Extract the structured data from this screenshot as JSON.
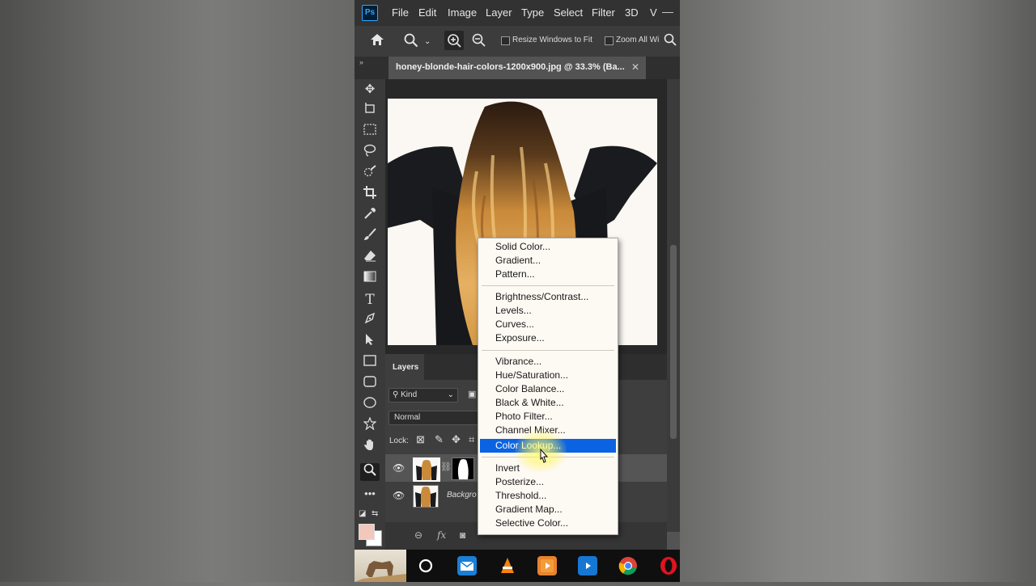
{
  "app": {
    "logo": "Ps"
  },
  "menu": {
    "items": [
      "File",
      "Edit",
      "Image",
      "Layer",
      "Type",
      "Select",
      "Filter",
      "3D",
      "V"
    ]
  },
  "options": {
    "resize_windows": "Resize Windows to Fit",
    "zoom_all": "Zoom All Wi"
  },
  "document": {
    "tab_title": "honey-blonde-hair-colors-1200x900.jpg @ 33.3% (Ba..."
  },
  "layers_panel": {
    "title": "Layers",
    "filter_label": "Kind",
    "blend_mode": "Normal",
    "lock_label": "Lock:",
    "layers": [
      {
        "name": "",
        "has_mask": true
      },
      {
        "name": "Backgro"
      }
    ]
  },
  "context_menu": {
    "groups": [
      [
        "Solid Color...",
        "Gradient...",
        "Pattern..."
      ],
      [
        "Brightness/Contrast...",
        "Levels...",
        "Curves...",
        "Exposure..."
      ],
      [
        "Vibrance...",
        "Hue/Saturation...",
        "Color Balance...",
        "Black & White...",
        "Photo Filter...",
        "Channel Mixer...",
        "Color Lookup..."
      ],
      [
        "Invert",
        "Posterize...",
        "Threshold...",
        "Gradient Map...",
        "Selective Color..."
      ]
    ],
    "highlighted": "Color Lookup..."
  },
  "colors": {
    "foreground": "#f3c8bc",
    "background": "#ffffff",
    "highlight": "#0a63e3"
  }
}
